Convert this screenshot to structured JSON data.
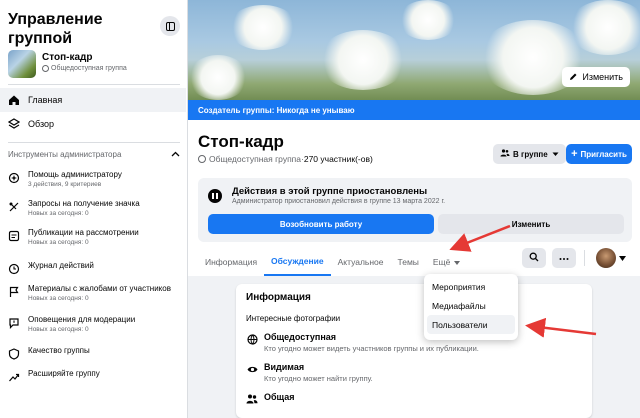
{
  "sidebar": {
    "title": "Управление группой",
    "group_name": "Стоп-кадр",
    "group_privacy": "Общедоступная группа",
    "nav": [
      {
        "label": "Главная",
        "icon": "home-icon",
        "active": true
      },
      {
        "label": "Обзор",
        "icon": "overview-icon",
        "active": false
      }
    ],
    "tools_heading": "Инструменты администратора",
    "tools": [
      {
        "label": "Помощь администратору",
        "sub": "3 действия, 9 критериев",
        "icon": "admin-assist-icon"
      },
      {
        "label": "Запросы на получение значка",
        "sub": "Новых за сегодня: 0",
        "icon": "badge-icon"
      },
      {
        "label": "Публикации на рассмотрении",
        "sub": "Новых за сегодня: 0",
        "icon": "pending-posts-icon"
      },
      {
        "label": "Журнал действий",
        "sub": "",
        "icon": "activity-log-icon"
      },
      {
        "label": "Материалы с жалобами от участников",
        "sub": "Новых за сегодня: 0",
        "icon": "reported-icon"
      },
      {
        "label": "Оповещения для модерации",
        "sub": "Новых за сегодня: 0",
        "icon": "moderation-alerts-icon"
      },
      {
        "label": "Качество группы",
        "sub": "",
        "icon": "group-quality-icon"
      },
      {
        "label": "Расширяйте группу",
        "sub": "",
        "icon": "grow-group-icon"
      }
    ]
  },
  "cover": {
    "edit_label": "Изменить",
    "creator_text": "Создатель группы: Никогда не унываю"
  },
  "header": {
    "title": "Стоп-кадр",
    "privacy": "Общедоступная группа",
    "separator": " · ",
    "members": "270 участник(-ов)",
    "in_group_label": "В группе",
    "invite_label": "Пригласить"
  },
  "paused": {
    "title": "Действия в этой группе приостановлены",
    "subtitle": "Администратор приостановил действия в группе 13 марта 2022 г.",
    "resume_label": "Возобновить работу",
    "change_label": "Изменить"
  },
  "tabs": [
    {
      "label": "Информация",
      "active": false
    },
    {
      "label": "Обсуждение",
      "active": true
    },
    {
      "label": "Актуальное",
      "active": false
    },
    {
      "label": "Темы",
      "active": false
    },
    {
      "label": "Ещё",
      "active": false
    }
  ],
  "more_menu": {
    "items": [
      "Мероприятия",
      "Медиафайлы",
      "Пользователи"
    ],
    "highlighted": "Пользователи"
  },
  "info_card": {
    "title": "Информация",
    "photos_label": "Интересные фотографии",
    "rows": [
      {
        "title": "Общедоступная",
        "sub": "Кто угодно может видеть участников группы и их публикации.",
        "icon": "globe-icon"
      },
      {
        "title": "Видимая",
        "sub": "Кто угодно может найти группу.",
        "icon": "eye-icon"
      },
      {
        "title": "Общая",
        "sub": "",
        "icon": "people-icon"
      }
    ]
  },
  "colors": {
    "accent": "#1877f2",
    "annotation_arrow": "#e53935"
  }
}
